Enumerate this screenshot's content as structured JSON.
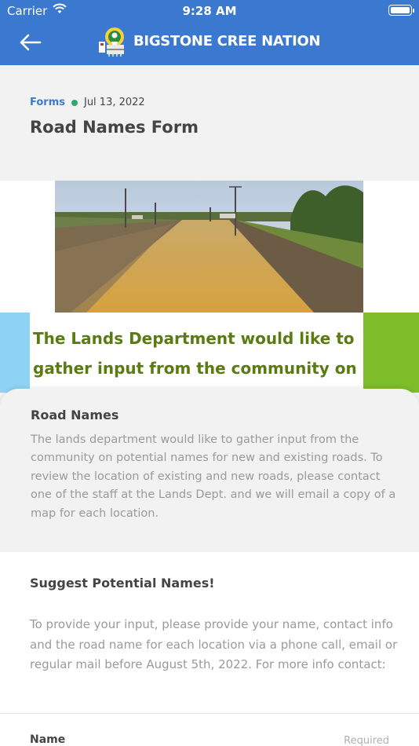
{
  "status_bar": {
    "carrier": "Carrier",
    "time": "9:28 AM"
  },
  "header": {
    "brand": "BIGSTONE CREE NATION",
    "icons": [
      "back-arrow-icon",
      "nation-logo"
    ]
  },
  "post": {
    "category": "Forms",
    "date": "Jul 13, 2022",
    "title": "Road Names Form"
  },
  "banner": {
    "text": "The Lands Department would like to gather input from the community on"
  },
  "card": {
    "heading": "Road Names",
    "body": "The lands department would like to gather input from the community on potential names for new and existing roads. To review the location of existing and new roads, please contact one of the staff at the Lands Dept. and we will email a copy of a map for each location."
  },
  "section": {
    "heading": "Suggest Potential Names!",
    "body": "To provide your input, please provide your name, contact info and the road name for each location via a phone call, email or regular mail before August 5th, 2022. For more info contact:"
  },
  "form": {
    "field_label": "Name",
    "field_hint": "Required"
  },
  "colors": {
    "header": "#3b78cf",
    "category": "#3b7bd1",
    "status_dot": "#2ea86b",
    "banner_text": "#5a7a12"
  }
}
